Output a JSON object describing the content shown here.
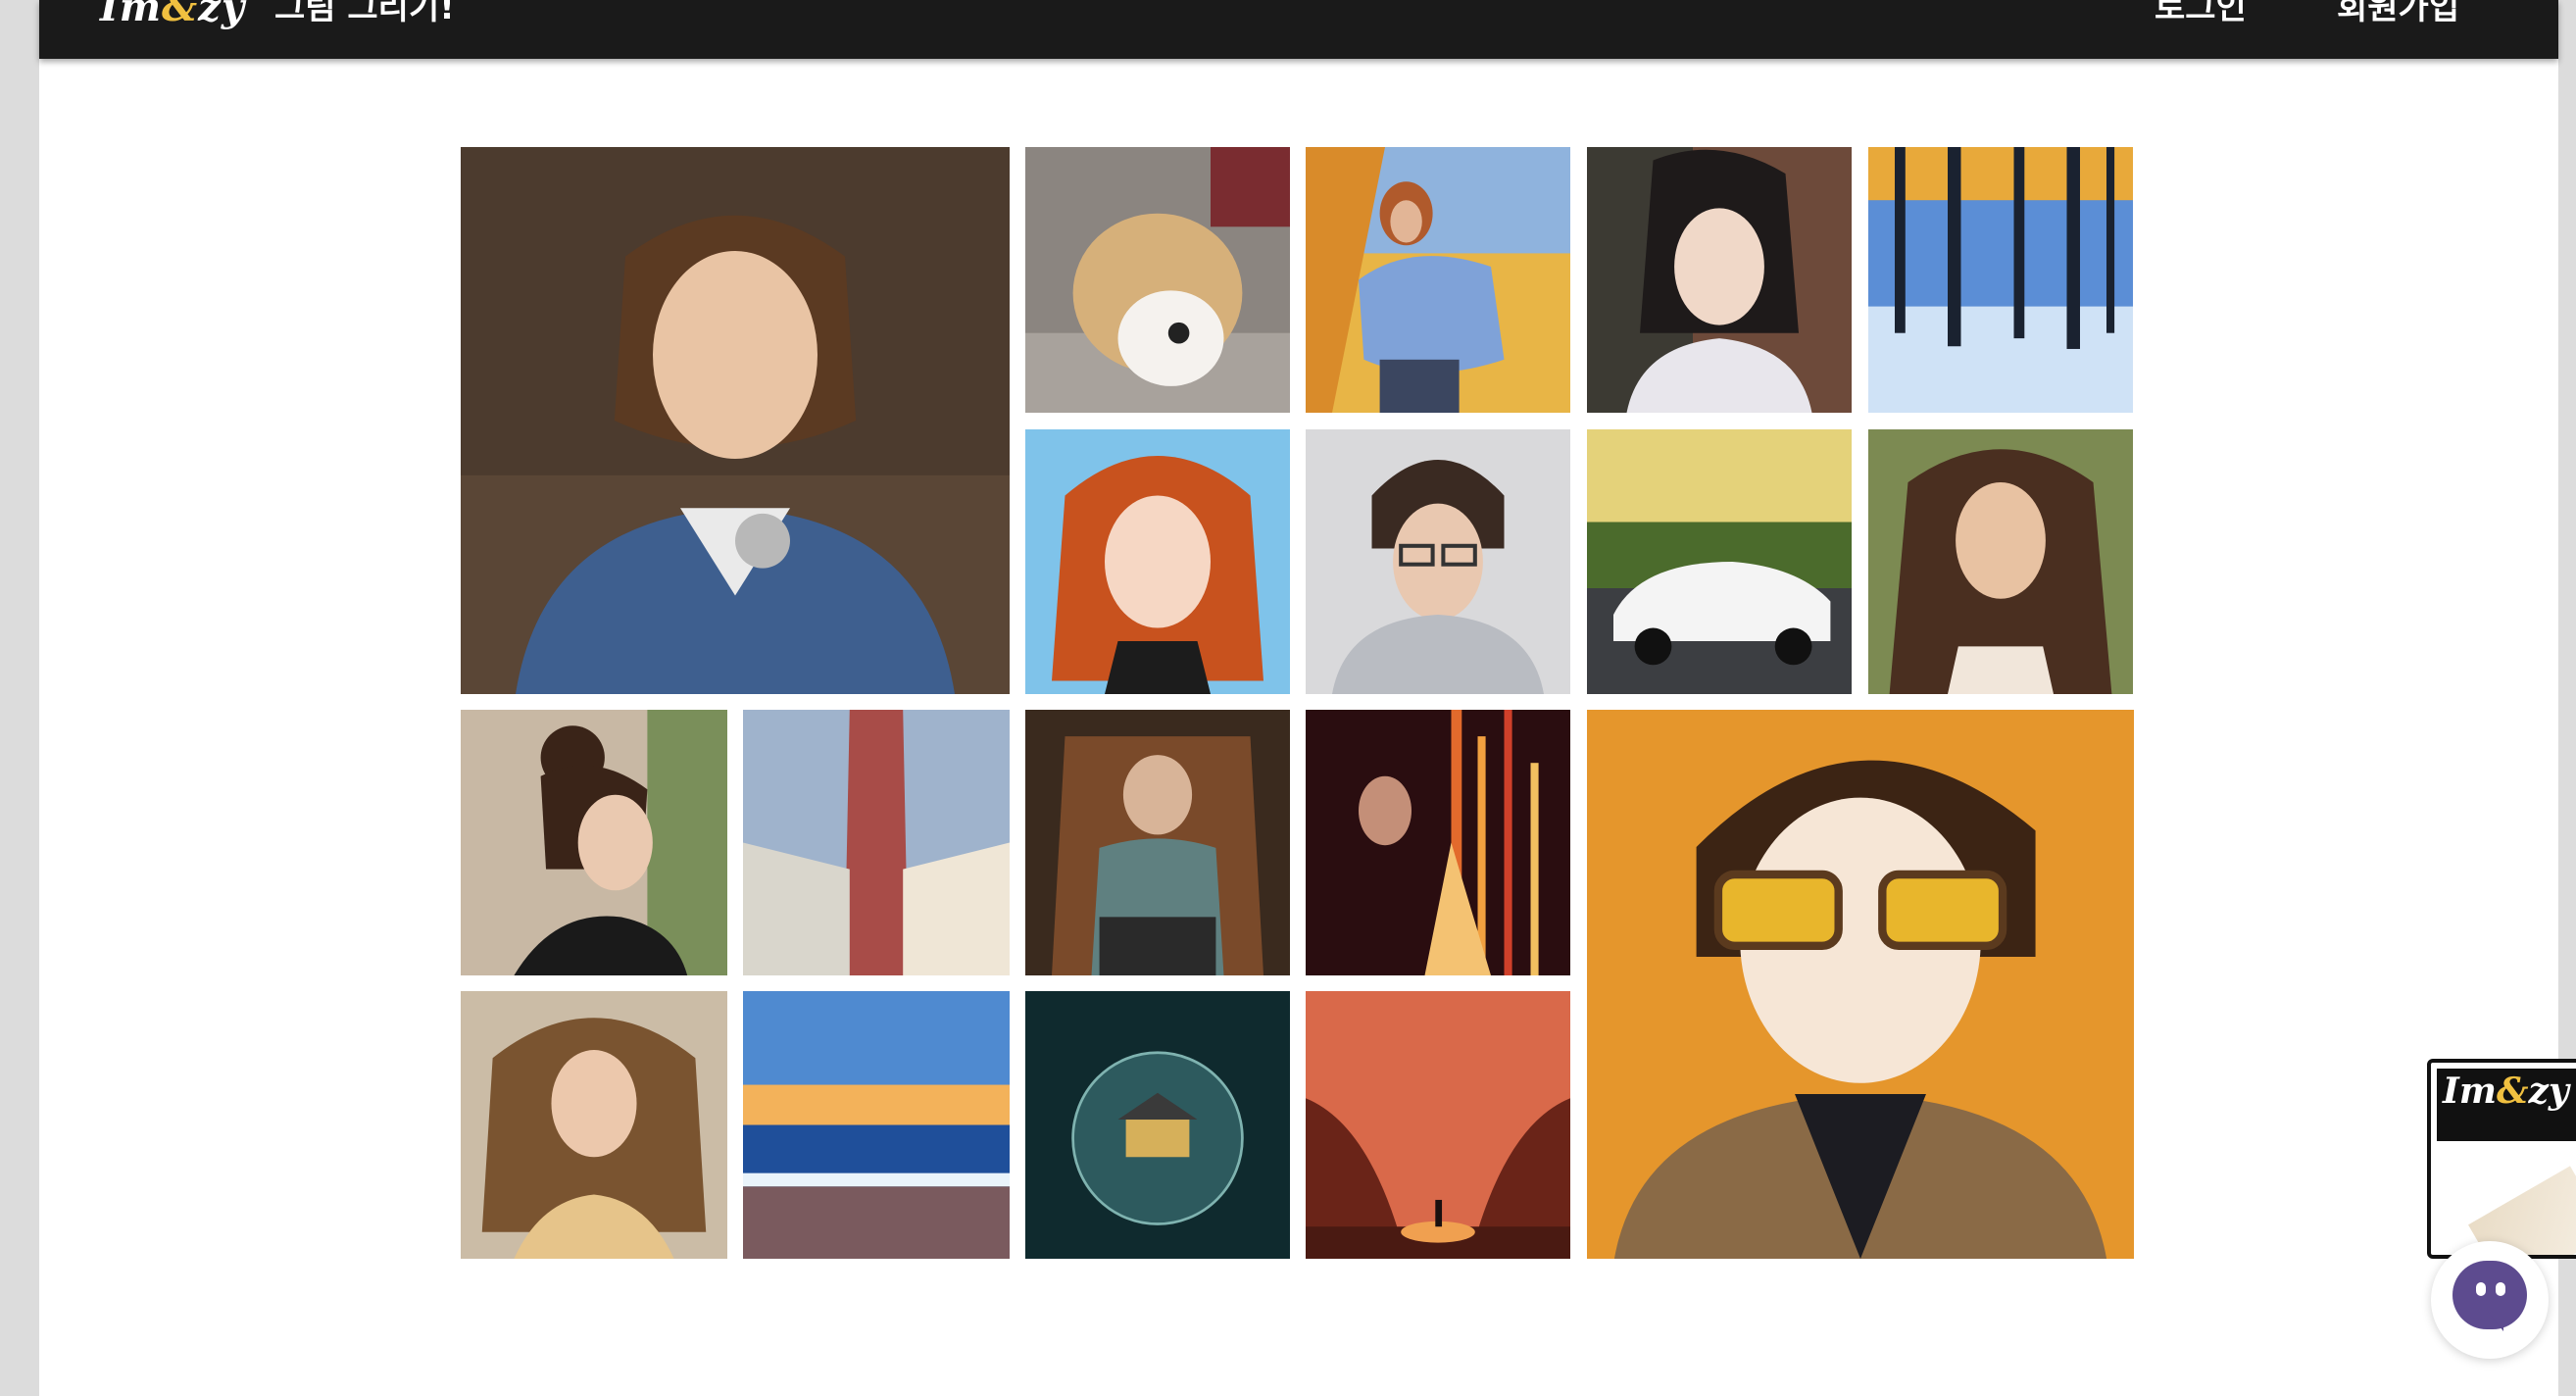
{
  "navbar": {
    "logo_text": "Im",
    "logo_dot": "&",
    "logo_tail": "zy",
    "draw_label": "그림 그리기!",
    "login_label": "로그인",
    "signup_label": "회원가입"
  },
  "gallery": {
    "images": [
      {
        "subject": "nurse-woman-portrait"
      },
      {
        "subject": "puppy"
      },
      {
        "subject": "woman-autumn-jacket"
      },
      {
        "subject": "asian-woman-portrait"
      },
      {
        "subject": "snowy-forest-sunrise"
      },
      {
        "subject": "anime-redhead-girl"
      },
      {
        "subject": "boy-glasses-hoodie"
      },
      {
        "subject": "white-sports-car"
      },
      {
        "subject": "woman-long-hair"
      },
      {
        "subject": "woman-hair-bun-profile"
      },
      {
        "subject": "tall-building"
      },
      {
        "subject": "old-man-armchair"
      },
      {
        "subject": "glowing-woman-light-streaks"
      },
      {
        "subject": "anime-boy-sunglasses"
      },
      {
        "subject": "curly-hair-woman"
      },
      {
        "subject": "ocean-sunset"
      },
      {
        "subject": "house-in-glass-sphere"
      },
      {
        "subject": "lone-figure-red-forest"
      }
    ]
  },
  "popup": {
    "logo_text": "Im",
    "logo_dot": "&",
    "logo_tail": "zy"
  },
  "colors": {
    "navbar": "#1a1a1a",
    "chat": "#5d4b8f",
    "logo_accent": "#f0c040"
  }
}
